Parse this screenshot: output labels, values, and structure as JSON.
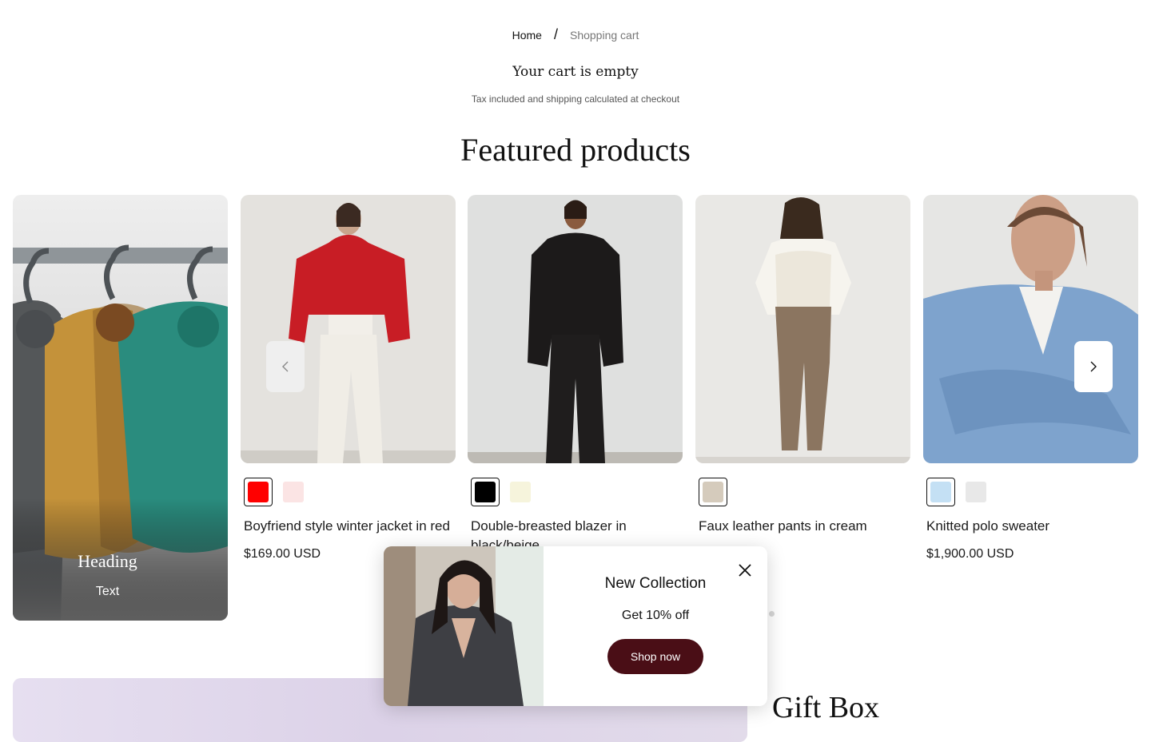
{
  "breadcrumb": {
    "home": "Home",
    "separator": "/",
    "current": "Shopping cart"
  },
  "cart": {
    "empty_title": "Your cart is empty",
    "tax_note": "Tax included and shipping calculated at checkout"
  },
  "featured": {
    "heading": "Featured products"
  },
  "promo": {
    "heading": "Heading",
    "text": "Text"
  },
  "products": [
    {
      "title": "Boyfriend style winter jacket in red",
      "price": "$169.00 USD",
      "swatches": [
        "#ff0000",
        "#fbe4e4"
      ],
      "selected": 0
    },
    {
      "title": "Double-breasted blazer in black/beige",
      "price": "",
      "swatches": [
        "#000000",
        "#f6f4dc"
      ],
      "selected": 0
    },
    {
      "title": "Faux leather pants in cream",
      "price": "USD",
      "swatches": [
        "#d5cbbc"
      ],
      "selected": 0
    },
    {
      "title": "Knitted polo sweater",
      "price": "$1,900.00 USD",
      "swatches": [
        "#c4e0f4",
        "#e8e8e8"
      ],
      "selected": 0
    }
  ],
  "nav": {
    "prev_icon": "chevron-left-icon",
    "next_icon": "chevron-right-icon"
  },
  "popup": {
    "title": "New Collection",
    "subtitle": "Get 10% off",
    "button": "Shop now",
    "close_icon": "close-icon",
    "button_color": "#4a0e16"
  },
  "gift": {
    "title": "Gift Box"
  }
}
